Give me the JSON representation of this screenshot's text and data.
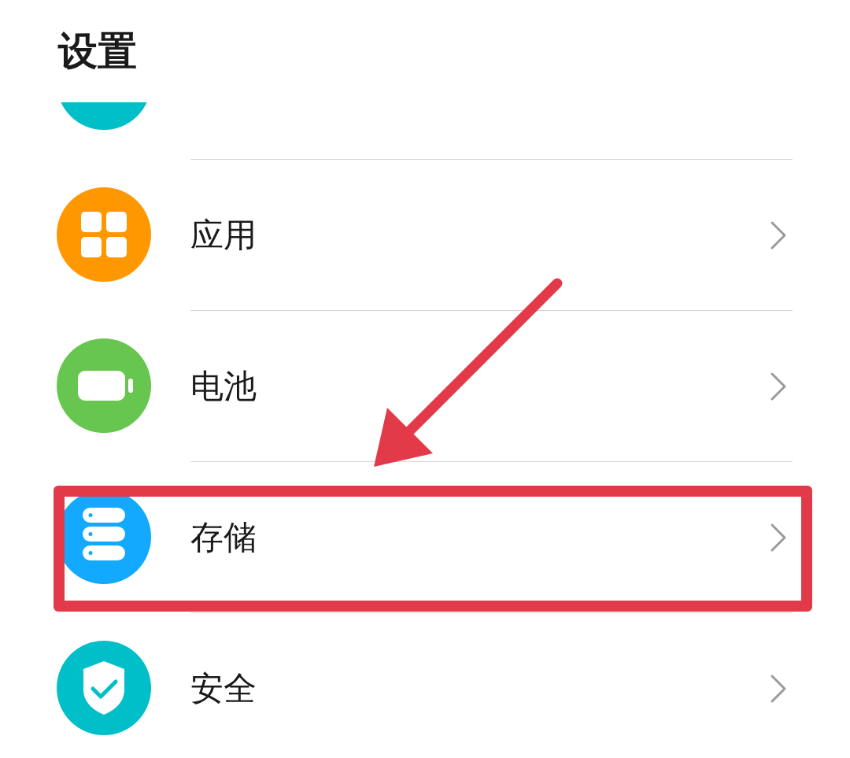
{
  "title": "设置",
  "items": [
    {
      "kind": "partial",
      "color": "#00bfc9",
      "highlighted": false
    },
    {
      "label": "应用",
      "kind": "grid",
      "color": "#ff9800",
      "highlighted": false
    },
    {
      "label": "电池",
      "kind": "battery",
      "color": "#67c64f",
      "highlighted": false
    },
    {
      "label": "存储",
      "kind": "storage",
      "color": "#12a9ff",
      "highlighted": true
    },
    {
      "label": "安全",
      "kind": "shield",
      "color": "#00bfc9",
      "highlighted": false
    }
  ]
}
